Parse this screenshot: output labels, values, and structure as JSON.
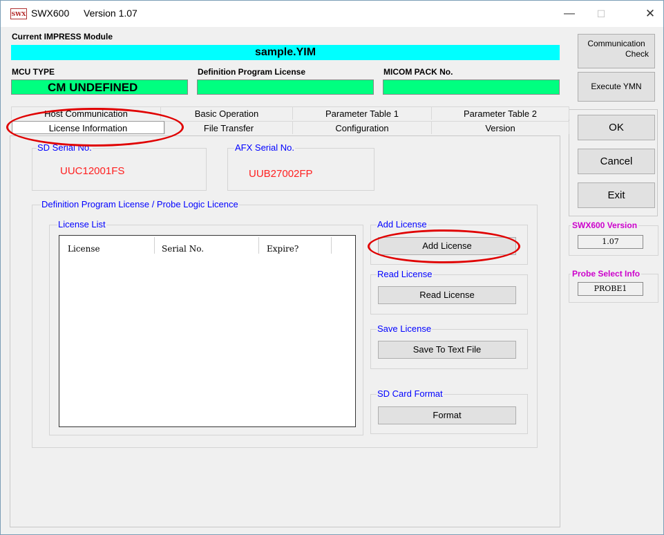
{
  "titlebar": {
    "icon_text": "SWX",
    "app_name": "SWX600",
    "version": "Version  1.07",
    "minimize": "—",
    "maximize": "☐",
    "close": "✕"
  },
  "impress": {
    "label": "Current IMPRESS Module",
    "value": "sample.YIM"
  },
  "mcu": {
    "type_label": "MCU TYPE",
    "type_value": "CM UNDEFINED",
    "license_label": "Definition Program License",
    "license_value": "",
    "micom_label": "MICOM PACK No.",
    "micom_value": ""
  },
  "side_buttons": {
    "comm_check_line1": "Communication",
    "comm_check_line2": "Check",
    "execute_ymn": "Execute YMN",
    "ok": "OK",
    "cancel": "Cancel",
    "exit": "Exit"
  },
  "tabs": {
    "row1": [
      "Host Communication",
      "Basic Operation",
      "Parameter Table 1",
      "Parameter Table 2"
    ],
    "row2": [
      "License Information",
      "File Transfer",
      "Configuration",
      "Version"
    ],
    "active": "License Information"
  },
  "serials": {
    "sd_label": "SD Serial No.",
    "sd_value": "UUC12001FS",
    "afx_label": "AFX Serial No.",
    "afx_value": "UUB27002FP"
  },
  "license_group": {
    "title": "Definition Program License / Probe Logic Licence",
    "list_title": "License List",
    "columns": [
      "License",
      "Serial No.",
      "Expire?"
    ]
  },
  "actions": {
    "add_title": "Add License",
    "add_button": "Add License",
    "read_title": "Read License",
    "read_button": "Read License",
    "save_title": "Save License",
    "save_button": "Save To Text File",
    "format_title": "SD Card Format",
    "format_button": "Format"
  },
  "info": {
    "version_label": "SWX600 Version",
    "version_value": "1.07",
    "probe_label": "Probe Select Info",
    "probe_value": "PROBE1"
  },
  "colors": {
    "impress_bar": "#00ffff",
    "green_field": "#00ff80",
    "serial_text": "#ff2020",
    "group_title": "#0000ff",
    "info_label": "#cc00cc",
    "annotation": "#e00000"
  }
}
